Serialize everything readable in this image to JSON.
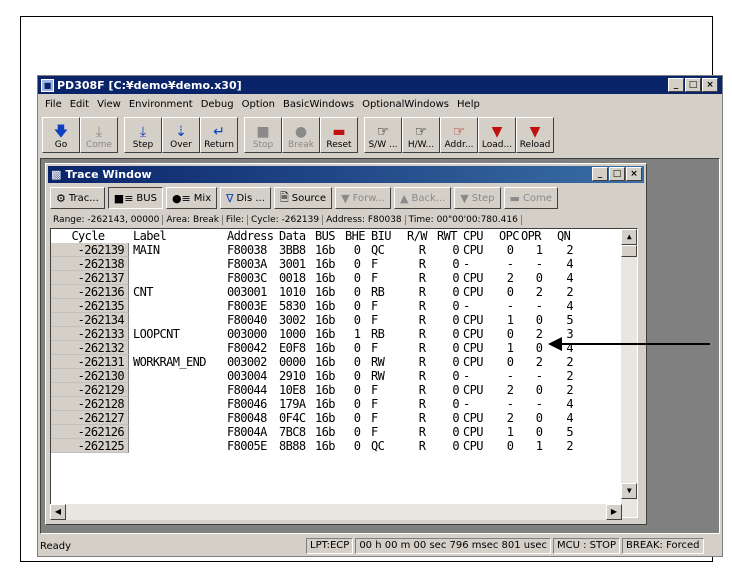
{
  "window": {
    "title": "PD308F [C:¥demo¥demo.x30]"
  },
  "menu": [
    "File",
    "Edit",
    "View",
    "Environment",
    "Debug",
    "Option",
    "BasicWindows",
    "OptionalWindows",
    "Help"
  ],
  "toolbar": [
    {
      "label": "Go",
      "icon": "arrow-down-icon",
      "enabled": true
    },
    {
      "label": "Come",
      "icon": "arrow-down-bar-icon",
      "enabled": false
    },
    {
      "label": "Step",
      "icon": "step-icon",
      "enabled": true
    },
    {
      "label": "Over",
      "icon": "step-over-icon",
      "enabled": true
    },
    {
      "label": "Return",
      "icon": "return-icon",
      "enabled": true
    },
    {
      "label": "Stop",
      "icon": "stop-icon",
      "enabled": false
    },
    {
      "label": "Break",
      "icon": "break-icon",
      "enabled": false
    },
    {
      "label": "Reset",
      "icon": "reset-icon",
      "enabled": true
    },
    {
      "label": "S/W ...",
      "icon": "software-breakpoint-icon",
      "enabled": true
    },
    {
      "label": "H/W...",
      "icon": "hardware-breakpoint-icon",
      "enabled": true
    },
    {
      "label": "Addr...",
      "icon": "address-icon",
      "enabled": true
    },
    {
      "label": "Load...",
      "icon": "load-icon",
      "enabled": true
    },
    {
      "label": "Reload",
      "icon": "reload-icon",
      "enabled": true
    }
  ],
  "trace": {
    "title": "Trace Window",
    "buttons": [
      {
        "label": "Trac...",
        "icon": "trace-icon",
        "enabled": true
      },
      {
        "label": "BUS",
        "icon": "bus-icon",
        "enabled": true,
        "pressed": true
      },
      {
        "label": "Mix",
        "icon": "mix-icon",
        "enabled": true
      },
      {
        "label": "Dis ...",
        "icon": "disassemble-icon",
        "enabled": true
      },
      {
        "label": "Source",
        "icon": "source-icon",
        "enabled": true
      },
      {
        "label": "Forw...",
        "icon": "forward-icon",
        "enabled": false
      },
      {
        "label": "Back...",
        "icon": "back-icon",
        "enabled": false
      },
      {
        "label": "Step",
        "icon": "step-icon",
        "enabled": false
      },
      {
        "label": "Come",
        "icon": "come-icon",
        "enabled": false
      }
    ],
    "info": {
      "range": "Range: -262143, 00000",
      "area": "Area: Break",
      "file": "File:",
      "cycle": "Cycle: -262139",
      "address": "Address: F80038",
      "time": "Time: 00\"00'00:780.416"
    },
    "columns": [
      "Cycle",
      "Label",
      "Address",
      "Data",
      "BUS",
      "BHE",
      "BIU",
      "R/W",
      "RWT",
      "CPU",
      "OPC",
      "OPR",
      "QN"
    ],
    "rows": [
      [
        "-262139",
        "MAIN",
        "F80038",
        "3BB8",
        "16b",
        "0",
        "QC",
        "R",
        "0",
        "CPU",
        "0",
        "1",
        "2"
      ],
      [
        "-262138",
        "",
        "F8003A",
        "3001",
        "16b",
        "0",
        "F",
        "R",
        "0",
        "-",
        "-",
        "-",
        "4"
      ],
      [
        "-262137",
        "",
        "F8003C",
        "0018",
        "16b",
        "0",
        "F",
        "R",
        "0",
        "CPU",
        "2",
        "0",
        "4"
      ],
      [
        "-262136",
        "CNT",
        "003001",
        "1010",
        "16b",
        "0",
        "RB",
        "R",
        "0",
        "CPU",
        "0",
        "2",
        "2"
      ],
      [
        "-262135",
        "",
        "F8003E",
        "5830",
        "16b",
        "0",
        "F",
        "R",
        "0",
        "-",
        "-",
        "-",
        "4"
      ],
      [
        "-262134",
        "",
        "F80040",
        "3002",
        "16b",
        "0",
        "F",
        "R",
        "0",
        "CPU",
        "1",
        "0",
        "5"
      ],
      [
        "-262133",
        "LOOPCNT",
        "003000",
        "1000",
        "16b",
        "1",
        "RB",
        "R",
        "0",
        "CPU",
        "0",
        "2",
        "3"
      ],
      [
        "-262132",
        "",
        "F80042",
        "E0F8",
        "16b",
        "0",
        "F",
        "R",
        "0",
        "CPU",
        "1",
        "0",
        "4"
      ],
      [
        "-262131",
        "WORKRAM_END",
        "003002",
        "0000",
        "16b",
        "0",
        "RW",
        "R",
        "0",
        "CPU",
        "0",
        "2",
        "2"
      ],
      [
        "-262130",
        "",
        "003004",
        "2910",
        "16b",
        "0",
        "RW",
        "R",
        "0",
        "-",
        "-",
        "-",
        "2"
      ],
      [
        "-262129",
        "",
        "F80044",
        "10E8",
        "16b",
        "0",
        "F",
        "R",
        "0",
        "CPU",
        "2",
        "0",
        "2"
      ],
      [
        "-262128",
        "",
        "F80046",
        "179A",
        "16b",
        "0",
        "F",
        "R",
        "0",
        "-",
        "-",
        "-",
        "4"
      ],
      [
        "-262127",
        "",
        "F80048",
        "0F4C",
        "16b",
        "0",
        "F",
        "R",
        "0",
        "CPU",
        "2",
        "0",
        "4"
      ],
      [
        "-262126",
        "",
        "F8004A",
        "7BC8",
        "16b",
        "0",
        "F",
        "R",
        "0",
        "CPU",
        "1",
        "0",
        "5"
      ],
      [
        "-262125",
        "",
        "F8005E",
        "8B88",
        "16b",
        "0",
        "QC",
        "R",
        "0",
        "CPU",
        "0",
        "1",
        "2"
      ]
    ]
  },
  "status": {
    "ready": "Ready",
    "port": "LPT:ECP",
    "time": "00 h 00 m 00 sec 796 msec 801 usec",
    "mcu": "MCU : STOP",
    "break": "BREAK: Forced"
  }
}
